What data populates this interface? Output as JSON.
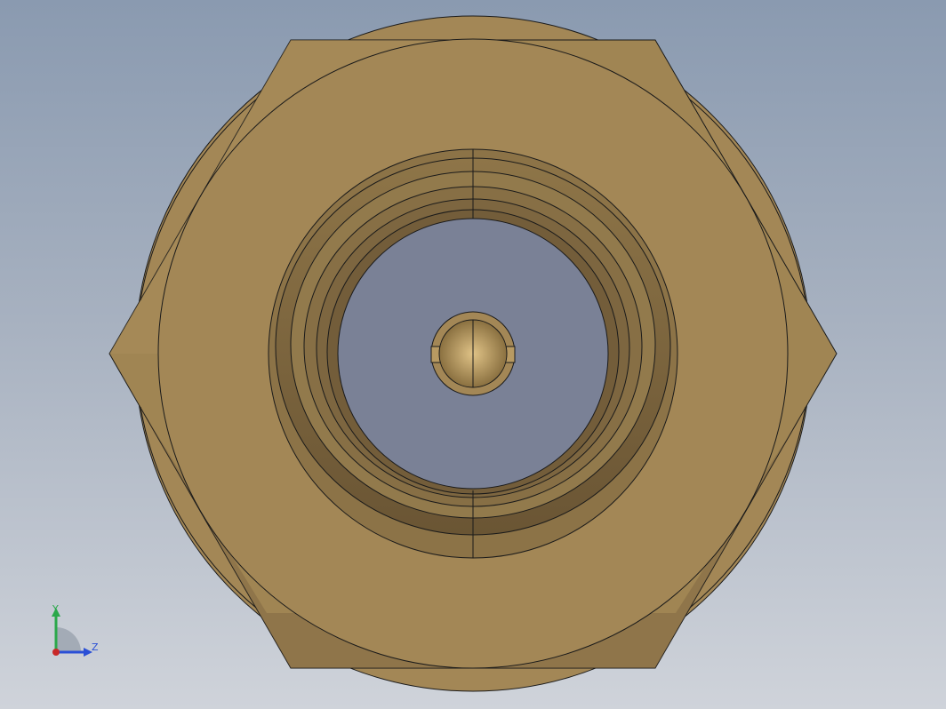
{
  "viewport": {
    "background_top": "#8a9ab0",
    "background_bottom": "#cfd3da"
  },
  "model": {
    "part_color": "#a38756",
    "part_light": "#b2945f",
    "part_dark": "#7a6440",
    "part_shadow": "#6f5a38",
    "bore_color": "#7a8196",
    "edge_color": "#1a1a1a"
  },
  "triad": {
    "y_label": "Y",
    "z_label": "Z",
    "y_color": "#2aa84a",
    "z_color": "#2a4fd6",
    "x_color": "#c82828"
  }
}
